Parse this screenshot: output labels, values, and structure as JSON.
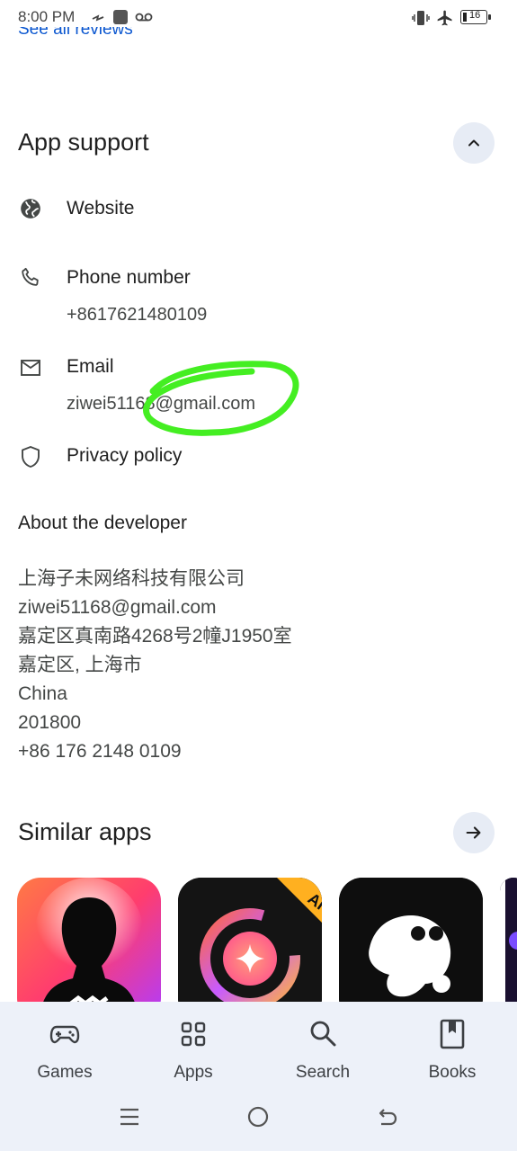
{
  "status_bar": {
    "time": "8:00 PM",
    "battery_level": "16"
  },
  "top_link": {
    "label": "See all reviews"
  },
  "app_support": {
    "title": "App support",
    "items": [
      {
        "icon": "globe-icon",
        "label": "Website"
      },
      {
        "icon": "phone-icon",
        "label": "Phone number",
        "value": "+8617621480109"
      },
      {
        "icon": "mail-icon",
        "label": "Email",
        "value": "ziwei51168@gmail.com"
      },
      {
        "icon": "shield-icon",
        "label": "Privacy policy"
      }
    ]
  },
  "about_developer": {
    "title": "About the developer",
    "lines": [
      "上海子未网络科技有限公司",
      "ziwei51168@gmail.com",
      "嘉定区真南路4268号2幢J1950室",
      "嘉定区, 上海市",
      "China",
      "201800",
      "+86 176 2148 0109"
    ]
  },
  "similar_apps": {
    "title": "Similar apps",
    "badge_text": "AI"
  },
  "bottom_nav": {
    "items": [
      {
        "label": "Games",
        "icon": "gamepad-icon"
      },
      {
        "label": "Apps",
        "icon": "apps-grid-icon"
      },
      {
        "label": "Search",
        "icon": "search-icon"
      },
      {
        "label": "Books",
        "icon": "book-icon"
      }
    ]
  },
  "colors": {
    "accent": "#0b57d0",
    "nav_bg": "#edf1f9",
    "highlight": "#44ee22"
  }
}
